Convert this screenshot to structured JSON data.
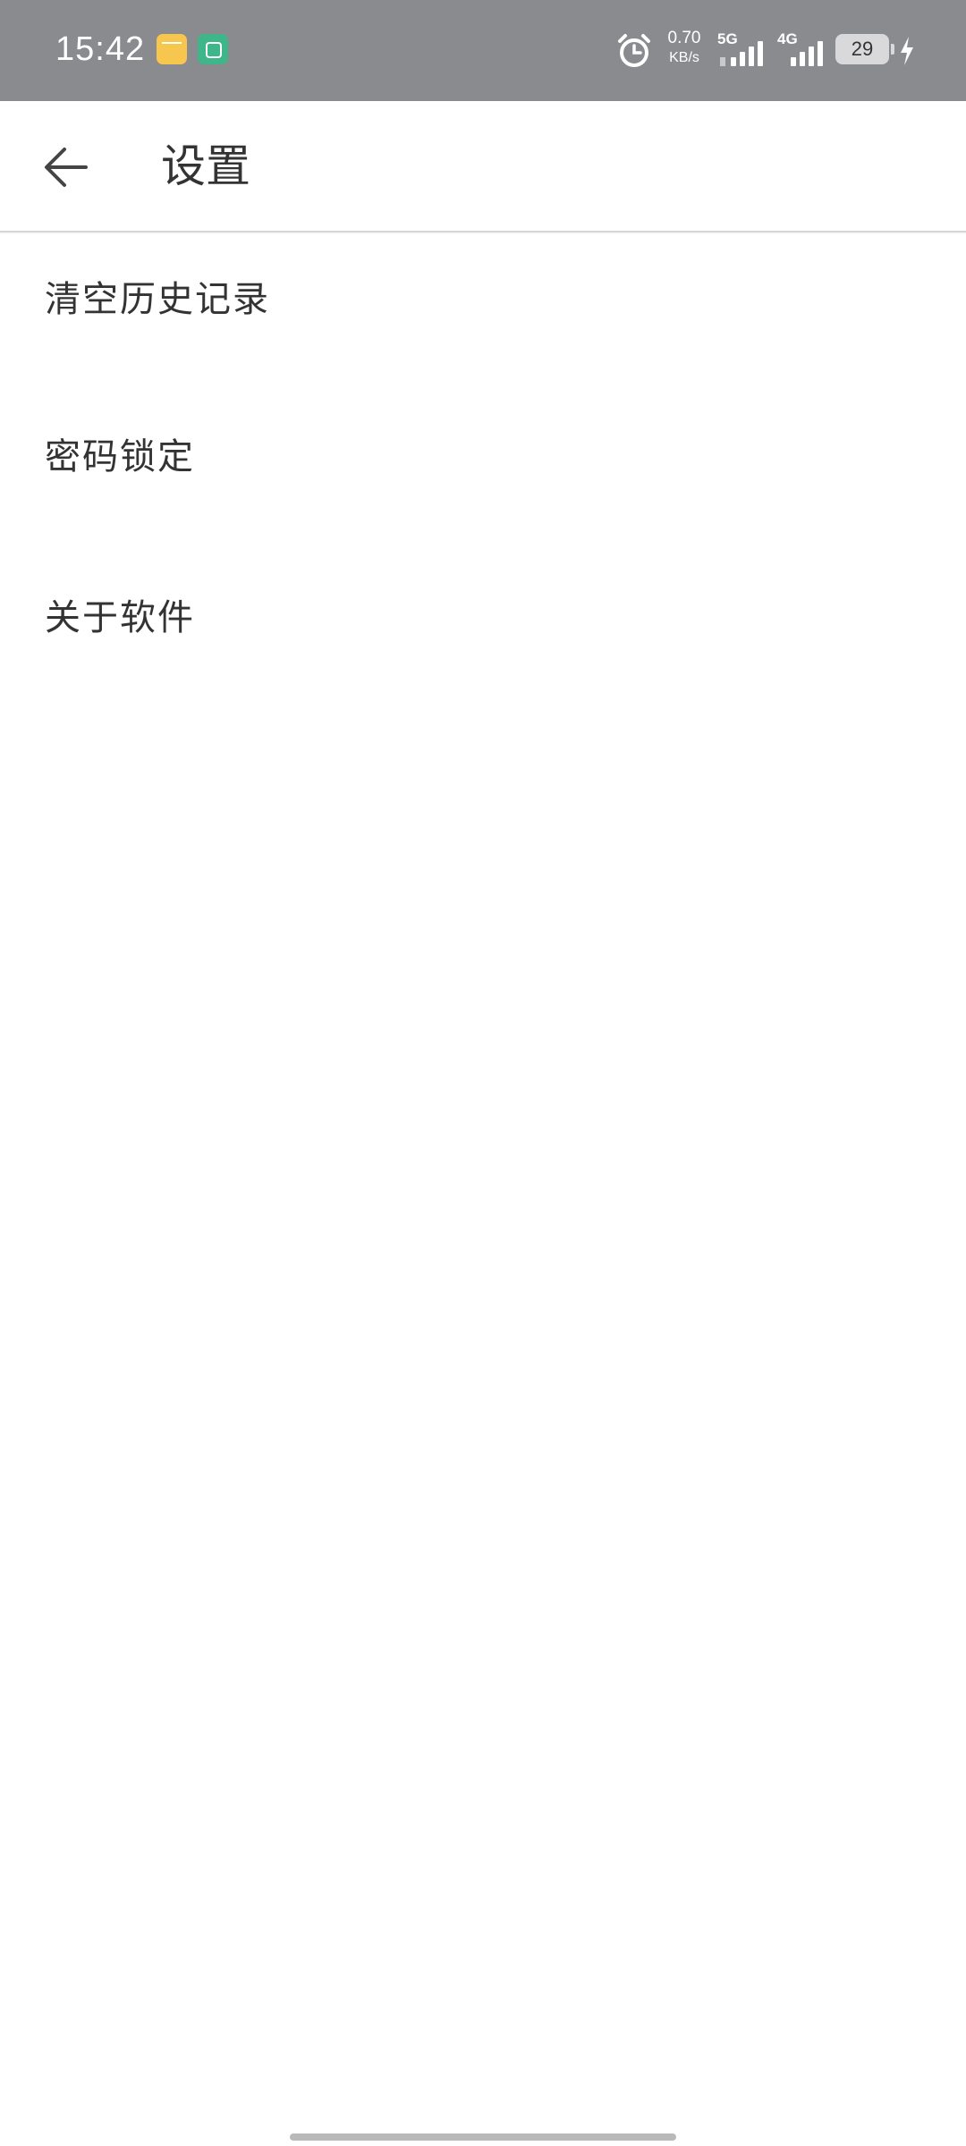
{
  "status_bar": {
    "time": "15:42",
    "app_icons": [
      "notes-app-icon",
      "wechat-app-icon"
    ],
    "alarm_icon": "alarm-icon",
    "speed_value": "0.70",
    "speed_unit": "KB/s",
    "network_1": "5G",
    "network_2": "4G",
    "battery_level": "29",
    "charging_icon": "bolt-icon",
    "colors": {
      "background": "#8a8b8f",
      "foreground": "#ffffff"
    }
  },
  "app_bar": {
    "back_icon": "arrow-left-icon",
    "title": "设置"
  },
  "settings": {
    "items": [
      {
        "label": "清空历史记录"
      },
      {
        "label": "密码锁定"
      },
      {
        "label": "关于软件"
      }
    ]
  }
}
